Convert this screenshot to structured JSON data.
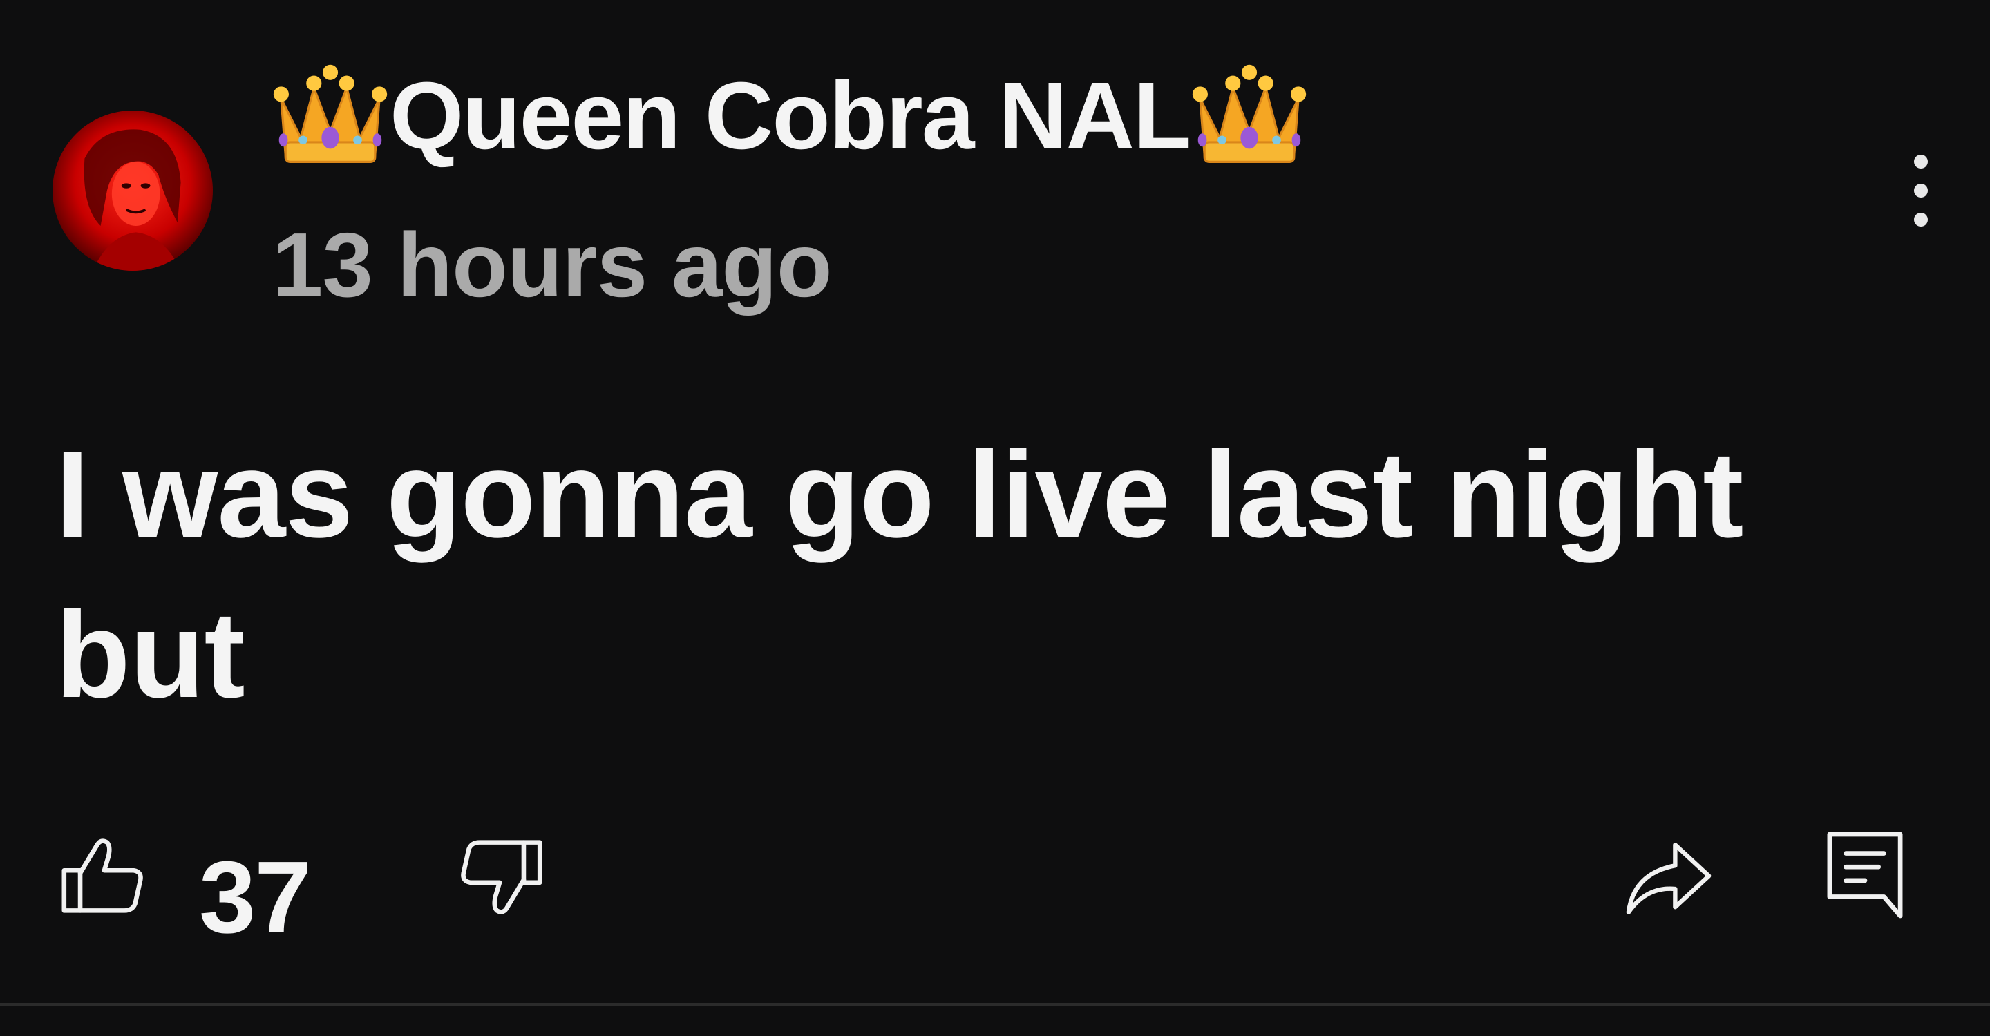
{
  "comment": {
    "author": {
      "name": "Queen Cobra NAL",
      "badge_left": "crown-emoji",
      "badge_right": "crown-emoji"
    },
    "timestamp": "13 hours ago",
    "text": "I was gonna go live last night but",
    "likes": "37",
    "icons": {
      "menu": "more-vertical-icon",
      "like": "thumbs-up-icon",
      "dislike": "thumbs-down-icon",
      "share": "share-arrow-icon",
      "reply": "comment-reply-icon"
    }
  },
  "colors": {
    "background": "#0e0e0f",
    "primary_text": "#f4f4f4",
    "secondary_text": "#aaaaaa",
    "avatar_accent": "#d10000"
  }
}
